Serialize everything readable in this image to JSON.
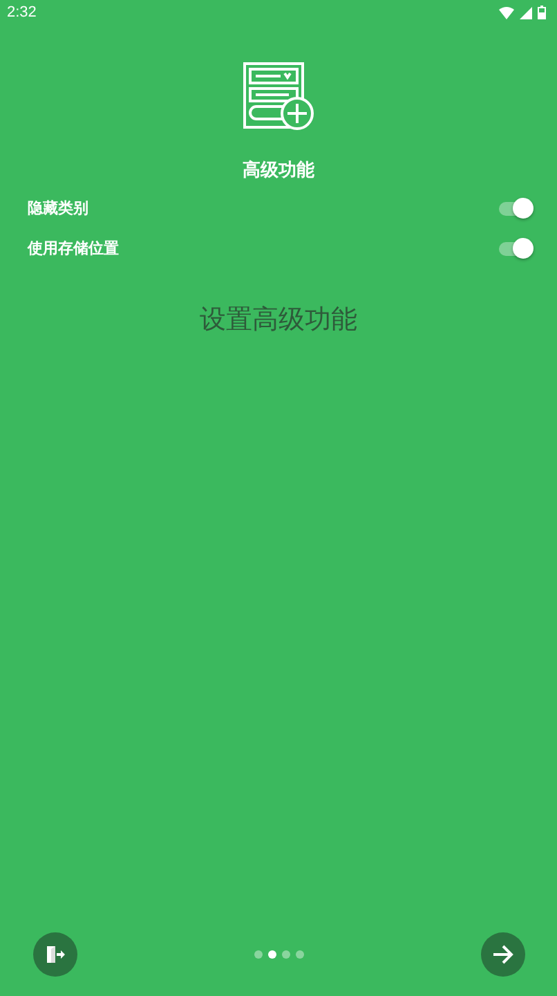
{
  "status_bar": {
    "time": "2:32"
  },
  "title": "高级功能",
  "settings": [
    {
      "label": "隐藏类别",
      "on": true
    },
    {
      "label": "使用存储位置",
      "on": true
    }
  ],
  "description": "设置高级功能",
  "pager": [
    {
      "selected": false
    },
    {
      "selected": true
    },
    {
      "selected": false
    },
    {
      "selected": false
    }
  ]
}
